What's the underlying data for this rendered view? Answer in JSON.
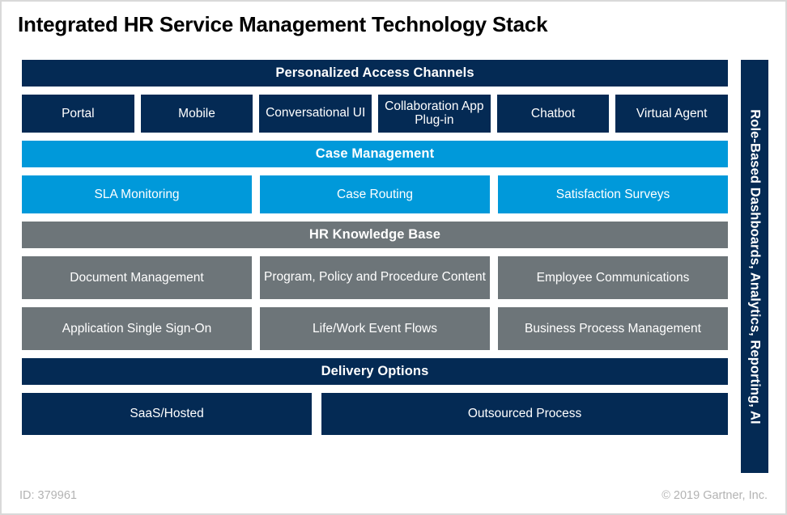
{
  "title": "Integrated HR Service Management Technology Stack",
  "colors": {
    "navy": "#042a54",
    "cyan": "#0099da",
    "gray": "#6d7579",
    "text_on_fill": "#ffffff",
    "footer_text": "#b3b3b3",
    "frame_border": "#d9d9d9"
  },
  "bands": [
    {
      "header": "Personalized Access Channels",
      "color": "navy",
      "items": [
        "Portal",
        "Mobile",
        "Conversational UI",
        "Collaboration App Plug-in",
        "Chatbot",
        "Virtual Agent"
      ]
    },
    {
      "header": "Case Management",
      "color": "cyan",
      "items": [
        "SLA Monitoring",
        "Case Routing",
        "Satisfaction Surveys"
      ]
    },
    {
      "header": "HR Knowledge Base",
      "color": "gray",
      "row1": [
        "Document Management",
        "Program, Policy and Procedure Content",
        "Employee Communications"
      ],
      "row2": [
        "Application Single Sign-On",
        "Life/Work Event Flows",
        "Business Process Management"
      ]
    },
    {
      "header": "Delivery Options",
      "color": "navy",
      "items": [
        "SaaS/Hosted",
        "Outsourced Process"
      ]
    }
  ],
  "sidebar": {
    "label": "Role-Based Dashboards, Analytics, Reporting, AI"
  },
  "footer": {
    "id": "ID: 379961",
    "copyright": "© 2019 Gartner, Inc."
  }
}
